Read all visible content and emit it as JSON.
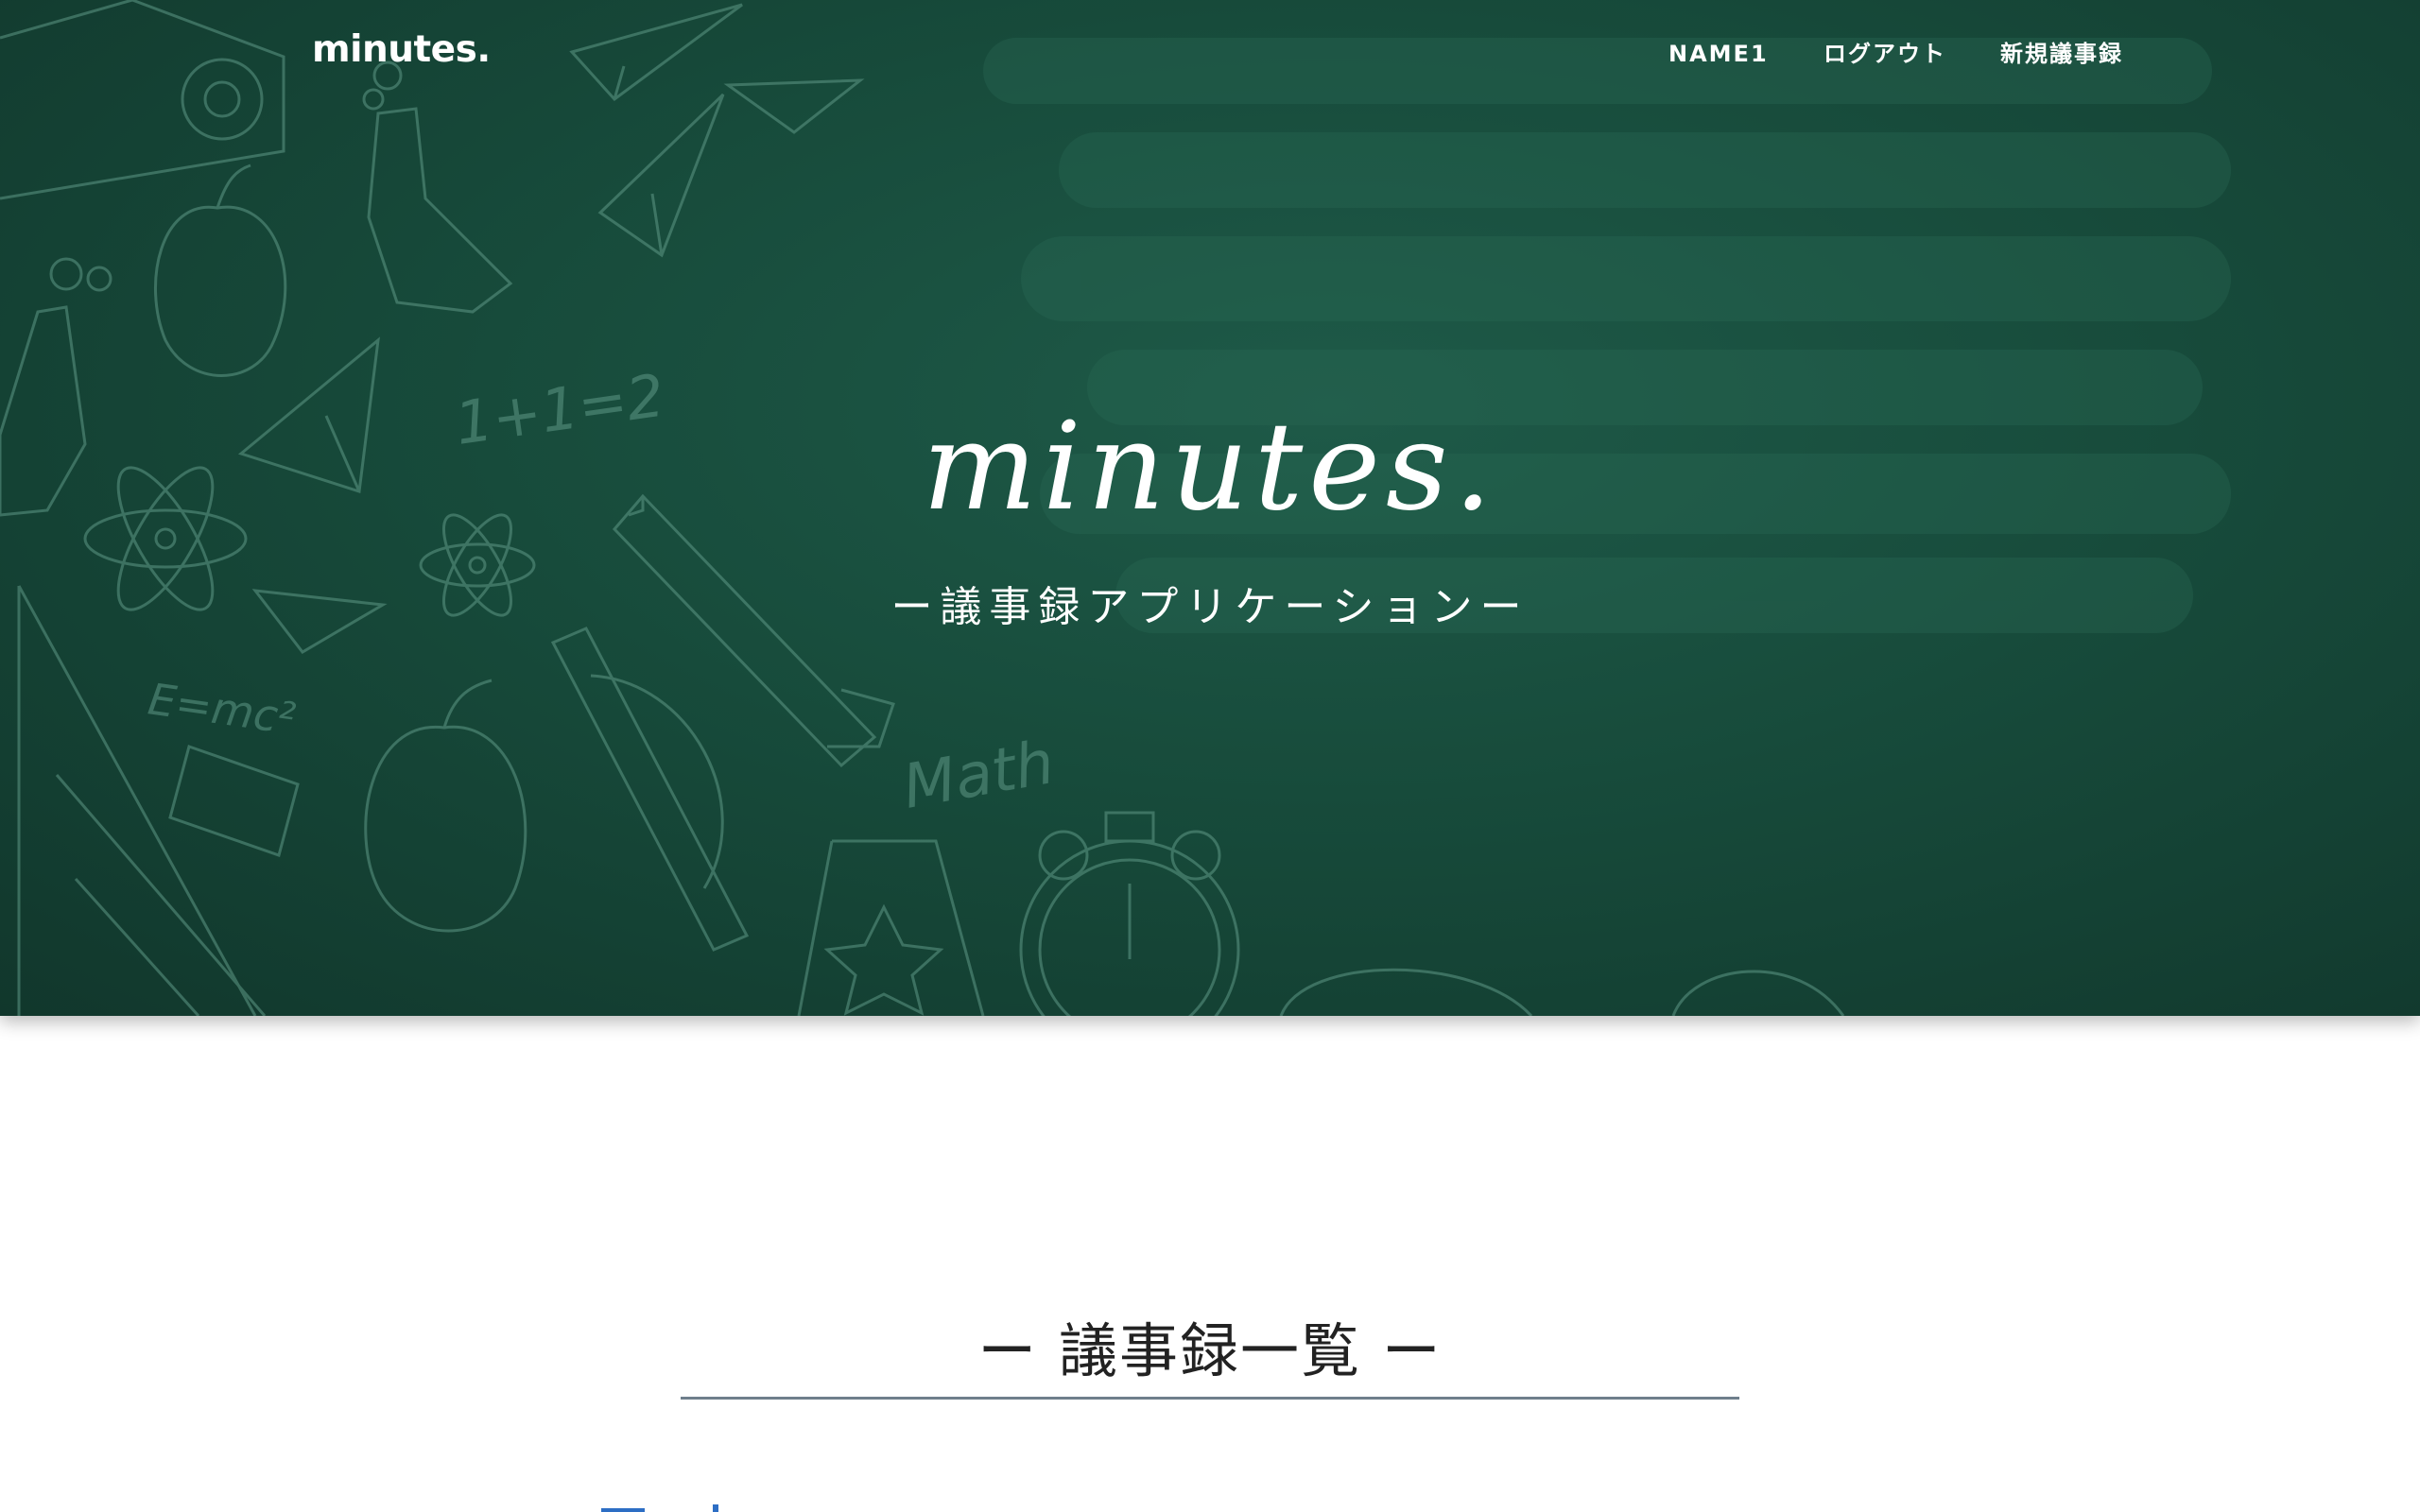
{
  "header": {
    "brand": "minutes.",
    "nav": {
      "user": "NAME1",
      "logout": "ログアウト",
      "new_minutes": "新規議事録"
    }
  },
  "hero": {
    "title": "minutes.",
    "subtitle": "ー議事録アプリケーションー",
    "chalk_doodles": [
      "1+1=2",
      "E=mc²",
      "Math"
    ]
  },
  "main": {
    "heading": "ー 議事録一覧 ー"
  },
  "colors": {
    "chalkboard": "#174b3b",
    "text_on_board": "#ffffff",
    "heading_text": "#222222",
    "rule": "#6f7f8c",
    "link": "#2d6ec4"
  }
}
